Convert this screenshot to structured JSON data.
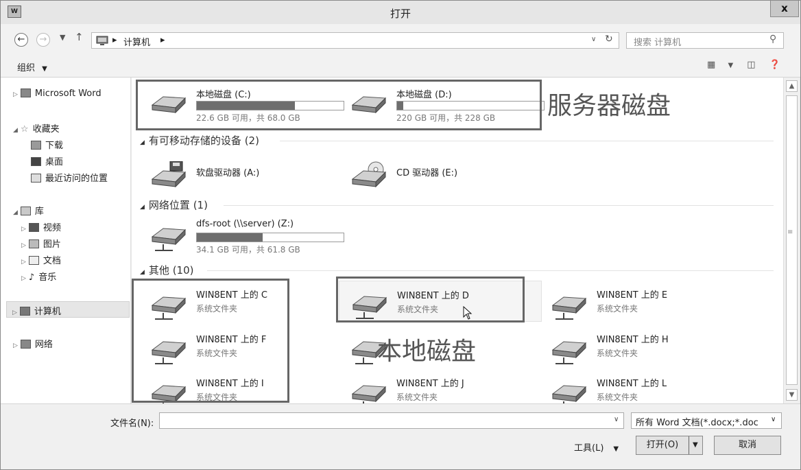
{
  "window": {
    "title": "打开",
    "close_label": "x",
    "app_icon_text": "W"
  },
  "address": {
    "breadcrumbs": [
      "计算机"
    ],
    "search_placeholder": "搜索 计算机"
  },
  "toolbar": {
    "organize_label": "组织"
  },
  "sidebar": {
    "items": [
      {
        "label": "Microsoft Word",
        "icon": "word-icon"
      },
      {
        "label": "收藏夹",
        "icon": "star-icon"
      },
      {
        "label": "下载",
        "icon": "download-icon"
      },
      {
        "label": "桌面",
        "icon": "desktop-icon"
      },
      {
        "label": "最近访问的位置",
        "icon": "recent-icon"
      },
      {
        "label": "库",
        "icon": "library-icon"
      },
      {
        "label": "视频",
        "icon": "video-icon"
      },
      {
        "label": "图片",
        "icon": "picture-icon"
      },
      {
        "label": "文档",
        "icon": "document-icon"
      },
      {
        "label": "音乐",
        "icon": "music-icon"
      },
      {
        "label": "计算机",
        "icon": "computer-icon"
      },
      {
        "label": "网络",
        "icon": "network-icon"
      }
    ]
  },
  "groups": {
    "removable": "有可移动存储的设备 (2)",
    "network": "网络位置 (1)",
    "other": "其他 (10)"
  },
  "drives": {
    "c": {
      "name": "本地磁盘 (C:)",
      "capacity": "22.6 GB 可用，共 68.0 GB",
      "used_fraction": 0.67
    },
    "d": {
      "name": "本地磁盘 (D:)",
      "capacity": "220 GB 可用，共 228 GB",
      "used_fraction": 0.04
    },
    "a": {
      "name": "软盘驱动器 (A:)"
    },
    "e": {
      "name": "CD 驱动器 (E:)"
    },
    "z": {
      "name": "dfs-root (\\\\server) (Z:)",
      "capacity": "34.1 GB 可用，共 61.8 GB",
      "used_fraction": 0.45
    }
  },
  "other_items": {
    "folder_type": "系统文件夹",
    "c": "WIN8ENT 上的 C",
    "d": "WIN8ENT 上的 D",
    "e": "WIN8ENT 上的 E",
    "f": "WIN8ENT 上的 F",
    "h": "WIN8ENT 上的 H",
    "i": "WIN8ENT 上的 I",
    "j": "WIN8ENT 上的 J",
    "l": "WIN8ENT 上的 L"
  },
  "annotations": {
    "server_disk": "服务器磁盘",
    "local_disk": "本地磁盘"
  },
  "bottom": {
    "filename_label": "文件名(N):",
    "filename_value": "",
    "filter_value": "所有 Word 文档(*.docx;*.doc",
    "tools_label": "工具(L)",
    "open_label": "打开(O)",
    "cancel_label": "取消"
  }
}
